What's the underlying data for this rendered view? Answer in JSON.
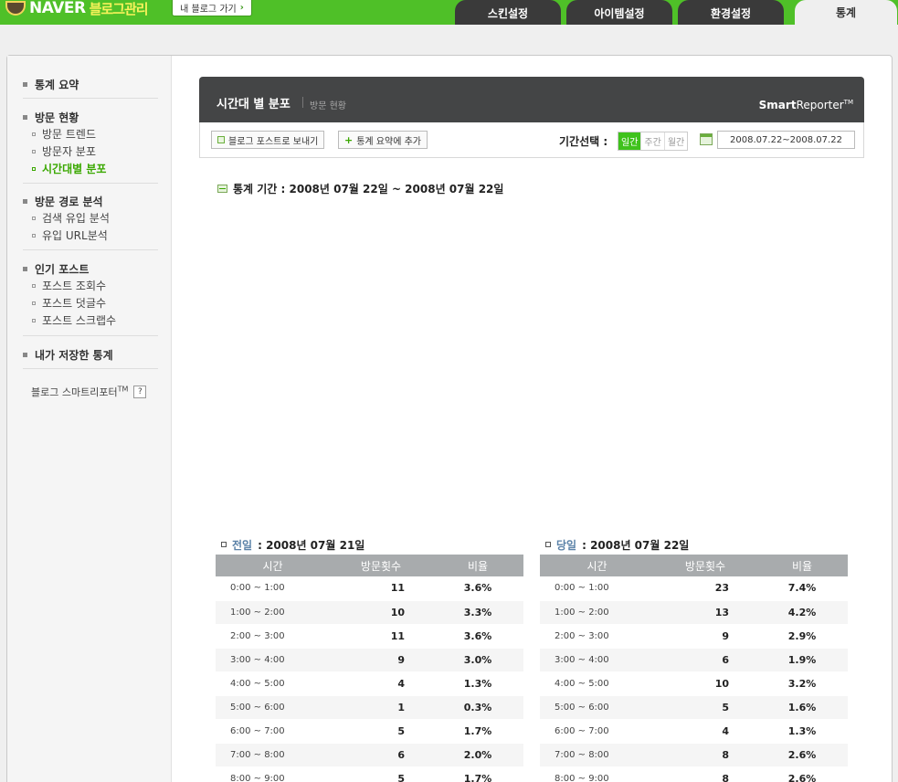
{
  "topbar": {
    "logo_text": "NAVER",
    "logo_sub": "블로그관리",
    "goto_blog": "내 블로그 가기",
    "goto_arrow": "›",
    "tabs": [
      "스킨설정",
      "아이템설정",
      "환경설정",
      "통계"
    ],
    "active_tab": "통계"
  },
  "sidebar": {
    "groups": [
      {
        "title": "통계 요약",
        "items": []
      },
      {
        "title": "방문 현황",
        "items": [
          "방문 트렌드",
          "방문자 분포",
          "시간대별 분포"
        ]
      },
      {
        "title": "방문 경로 분석",
        "items": [
          "검색 유입 분석",
          "유입 URL분석"
        ]
      },
      {
        "title": "인기 포스트",
        "items": [
          "포스트 조회수",
          "포스트 덧글수",
          "포스트 스크랩수"
        ]
      },
      {
        "title": "내가 저장한 통계",
        "items": []
      }
    ],
    "active_item": "시간대별 분포",
    "footer": "블로그 스마트리포터",
    "footer_sup": "TM",
    "help": "?"
  },
  "report": {
    "title": "시간대 별 분포",
    "subtitle": "방문 현황",
    "brand_bold": "Smart",
    "brand_rest": "Reporter",
    "brand_sup": "TM",
    "btn_send": "블로그 포스트로 보내기",
    "btn_add": "통계 요약에 추가",
    "period_label": "기간선택 :",
    "period_options": [
      "일간",
      "주간",
      "월간"
    ],
    "period_selected": "일간",
    "date_range": "2008.07.22~2008.07.22",
    "stat_period": "통계 기간 : 2008년 07월 22일 ~ 2008년 07월 22일"
  },
  "tables": [
    {
      "label": "전일",
      "date": ": 2008년 07월 21일",
      "headers": [
        "시간",
        "방문횟수",
        "비율"
      ],
      "rows": [
        [
          "0:00 ~ 1:00",
          "11",
          "3.6%"
        ],
        [
          "1:00 ~ 2:00",
          "10",
          "3.3%"
        ],
        [
          "2:00 ~ 3:00",
          "11",
          "3.6%"
        ],
        [
          "3:00 ~ 4:00",
          "9",
          "3.0%"
        ],
        [
          "4:00 ~ 5:00",
          "4",
          "1.3%"
        ],
        [
          "5:00 ~ 6:00",
          "1",
          "0.3%"
        ],
        [
          "6:00 ~ 7:00",
          "5",
          "1.7%"
        ],
        [
          "7:00 ~ 8:00",
          "6",
          "2.0%"
        ],
        [
          "8:00 ~ 9:00",
          "5",
          "1.7%"
        ]
      ]
    },
    {
      "label": "당일",
      "date": ": 2008년 07월 22일",
      "headers": [
        "시간",
        "방문횟수",
        "비율"
      ],
      "rows": [
        [
          "0:00 ~ 1:00",
          "23",
          "7.4%"
        ],
        [
          "1:00 ~ 2:00",
          "13",
          "4.2%"
        ],
        [
          "2:00 ~ 3:00",
          "9",
          "2.9%"
        ],
        [
          "3:00 ~ 4:00",
          "6",
          "1.9%"
        ],
        [
          "4:00 ~ 5:00",
          "10",
          "3.2%"
        ],
        [
          "5:00 ~ 6:00",
          "5",
          "1.6%"
        ],
        [
          "6:00 ~ 7:00",
          "4",
          "1.3%"
        ],
        [
          "7:00 ~ 8:00",
          "8",
          "2.6%"
        ],
        [
          "8:00 ~ 9:00",
          "8",
          "2.6%"
        ]
      ]
    }
  ]
}
